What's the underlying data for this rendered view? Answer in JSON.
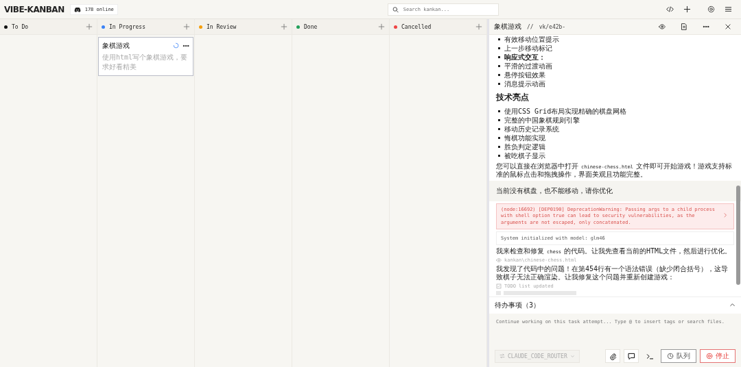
{
  "header": {
    "logo": "VIBE-KANBAN",
    "online": "178 online",
    "search_placeholder": "Search kankan..."
  },
  "columns": [
    {
      "title": "To Do",
      "color": "#111111"
    },
    {
      "title": "In Progress",
      "color": "#3b82f6",
      "cards": [
        {
          "title": "象棋游戏",
          "description": "使用html写个象棋游戏，要求好看精美",
          "running": true
        }
      ]
    },
    {
      "title": "In Review",
      "color": "#f59e0b"
    },
    {
      "title": "Done",
      "color": "#22a05a"
    },
    {
      "title": "Cancelled",
      "color": "#ef4444"
    }
  ],
  "panel": {
    "title": "象棋游戏",
    "separator": "//",
    "branch": "vk/e42b-",
    "conversation": [
      {
        "kind": "bullets",
        "items": [
          {
            "text": "有效移动位置提示",
            "bold": false
          },
          {
            "text": "上一步移动标记",
            "bold": false
          },
          {
            "text": "响应式交互：",
            "bold": true
          },
          {
            "text": "平滑的过渡动画",
            "bold": false
          },
          {
            "text": "悬停按钮效果",
            "bold": false
          },
          {
            "text": "消息提示动画",
            "bold": false
          }
        ]
      },
      {
        "kind": "heading",
        "text": "技术亮点"
      },
      {
        "kind": "bullets",
        "items": [
          {
            "text": "使用CSS Grid布局实现精确的棋盘网格",
            "bold": false
          },
          {
            "text": "完整的中国象棋规则引擎",
            "bold": false
          },
          {
            "text": "移动历史记录系统",
            "bold": false
          },
          {
            "text": "悔棋功能实现",
            "bold": false
          },
          {
            "text": "胜负判定逻辑",
            "bold": false
          },
          {
            "text": "被吃棋子显示",
            "bold": false
          }
        ]
      },
      {
        "kind": "paragraph",
        "before": "您可以直接在浏览器中打开",
        "code": "chinese-chess.html",
        "after": "文件即可开始游戏！游戏支持标准的鼠标点击和拖拽操作，界面美观且功能完整。"
      },
      {
        "kind": "user",
        "text": "当前没有棋盘，也不能移动，请你优化"
      },
      {
        "kind": "error",
        "text": "(node:16692) [DEP0190] DeprecationWarning: Passing args to a child process with shell option true can lead to security vulnerabilities, as the arguments are not escaped, only concatenated."
      },
      {
        "kind": "system",
        "text": "System initialized with model: glm46"
      },
      {
        "kind": "paragraph",
        "before": "我来检查和修复",
        "code": "chess",
        "after": "的代码。让我先查看当前的HTML文件，然后进行优化。"
      },
      {
        "kind": "file",
        "text": "kankan\\chinese-chess.html"
      },
      {
        "kind": "paragraph",
        "before": "我发现了代码中的问题！在第454行有一个语法错误（缺少闭合括号），这导致棋子无法正确渲染。让我修复这个问题并重新创建游戏："
      },
      {
        "kind": "todo",
        "text": "TODO list updated"
      },
      {
        "kind": "loading"
      }
    ],
    "todos": {
      "label": "待办事项（3）",
      "expanded": true
    },
    "input": {
      "placeholder": "Continue working on this task attempt... Type @ to insert tags or search files."
    },
    "agent": "CLAUDE_CODE_ROUTER",
    "queue_button": "队列",
    "stop_button": "停止"
  }
}
